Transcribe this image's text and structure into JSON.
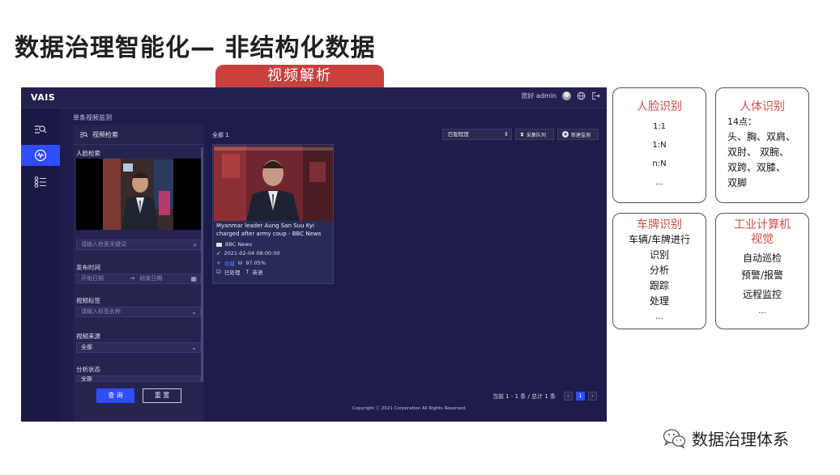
{
  "slide": {
    "title": "数据治理智能化— 非结构化数据",
    "banner": "视频解析"
  },
  "app": {
    "brand": "VAIS",
    "greeting": "您好 admin",
    "breadcrumb": "单条视频监测",
    "sidebar_items": [
      "search-list",
      "waveform",
      "list-settings"
    ],
    "filter_panel": {
      "heading": "视频检索",
      "face_search_label": "人脸检索",
      "keyword_placeholder": "请输入检索关键词",
      "publish_time_label": "发布时间",
      "start_date_placeholder": "开始日期",
      "range_arrow": "→",
      "end_date_placeholder": "结束日期",
      "tag_label": "视频标签",
      "tag_placeholder": "请输入标签名称",
      "source_label": "视频来源",
      "source_value": "全部",
      "status_label": "分析状态",
      "status_value": "全部",
      "query_button": "查 询",
      "reset_button": "重 置"
    },
    "results": {
      "total": "全部 1",
      "sort_select": "匹配程度",
      "queue_button": "采集队列",
      "new_monitor_button": "新建监测",
      "card": {
        "title": "Myanmar leader Aung San Suu Kyi charged after army coup - BBC News",
        "source": "BBC News",
        "datetime": "2021-02-04 08:00:00",
        "favorite": "收藏",
        "match": "97.05%",
        "status": "已处理",
        "language": "英语"
      }
    },
    "pager": {
      "summary": "当前 1 - 1 条 / 总计 1 条",
      "prev": "‹",
      "current": "1",
      "next": "›"
    },
    "copyright": "Copyright ⓒ 2021 Corporation All Rights Reserved."
  },
  "feature_boxes": [
    {
      "title": "人脸识别",
      "lines": [
        "1:1",
        "1:N",
        "n:N",
        "..."
      ]
    },
    {
      "title": "人体识别",
      "lines": [
        "14点：",
        "头、胸、双肩、",
        "双肘、 双腕、",
        "双跨、双膝、",
        "双脚"
      ]
    },
    {
      "title": "车牌识别",
      "lines": [
        "车辆/车牌进行",
        "识别",
        "分析",
        "跟踪",
        "处理",
        "..."
      ]
    },
    {
      "title": "工业计算机视觉",
      "lines": [
        "自动巡检",
        "预警/报警",
        "远程监控",
        "..."
      ]
    }
  ],
  "watermark": "数据治理体系",
  "colors": {
    "accent_blue": "#2f4cff",
    "app_bg": "#1d1c4a",
    "banner_red": "#c9413f",
    "box_title_red": "#d84a45"
  }
}
